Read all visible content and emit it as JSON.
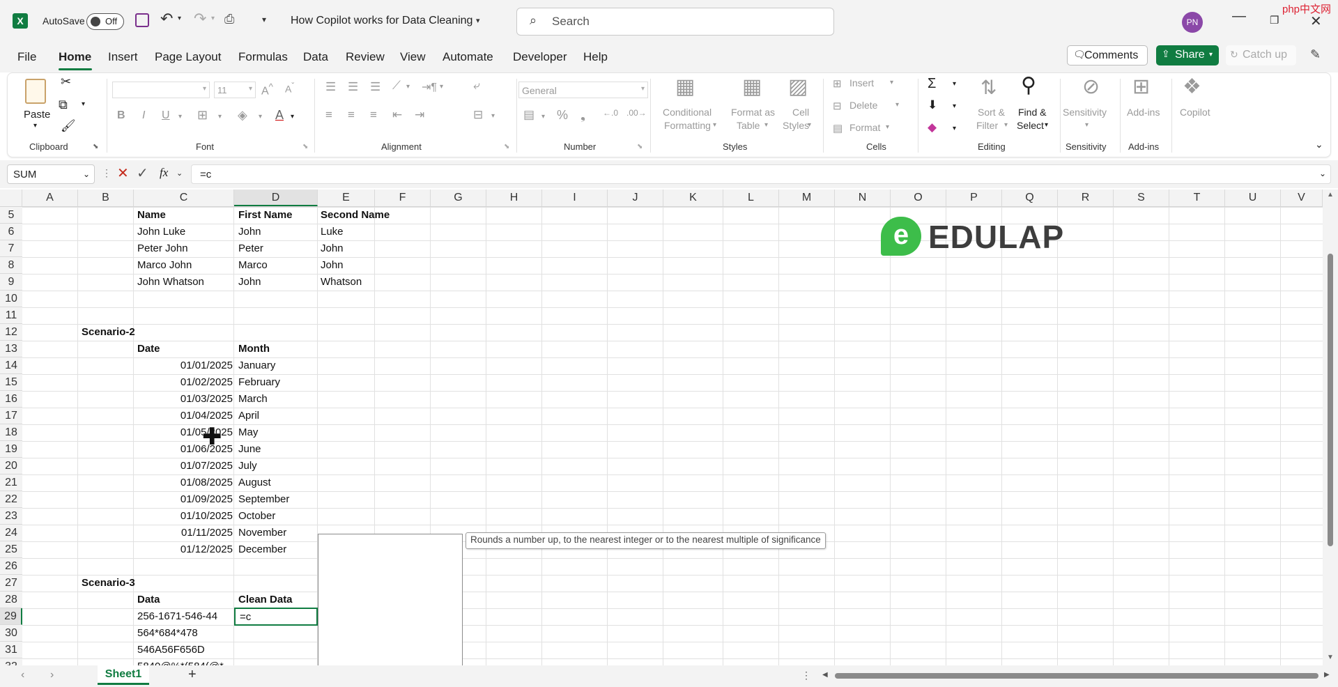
{
  "titlebar": {
    "autosave_label": "AutoSave",
    "autosave_state": "Off",
    "doc_title": "How Copilot works for Data Cleaning",
    "search_placeholder": "Search",
    "avatar_initials": "PN",
    "watermark": "php中文网"
  },
  "menu": {
    "tabs": [
      "File",
      "Home",
      "Insert",
      "Page Layout",
      "Formulas",
      "Data",
      "Review",
      "View",
      "Automate",
      "Developer",
      "Help"
    ],
    "comments": "Comments",
    "share": "Share",
    "catchup": "Catch up"
  },
  "ribbon": {
    "paste": "Paste",
    "font_size": "11",
    "number_format": "General",
    "cond_format": [
      "Conditional",
      "Formatting"
    ],
    "format_table": [
      "Format as",
      "Table"
    ],
    "cell_styles": [
      "Cell",
      "Styles"
    ],
    "cells": [
      "Insert",
      "Delete",
      "Format"
    ],
    "sort": [
      "Sort &",
      "Filter"
    ],
    "find": [
      "Find &",
      "Select"
    ],
    "sensitivity": "Sensitivity",
    "addins": "Add-ins",
    "copilot": "Copilot",
    "groups": [
      "Clipboard",
      "Font",
      "Alignment",
      "Number",
      "Styles",
      "Cells",
      "Editing",
      "Sensitivity",
      "Add-ins"
    ]
  },
  "formula_bar": {
    "name_box": "SUM",
    "fx": "fx",
    "formula": "=c"
  },
  "columns": [
    "A",
    "B",
    "C",
    "D",
    "E",
    "F",
    "G",
    "H",
    "I",
    "J",
    "K",
    "L",
    "M",
    "N",
    "O",
    "P",
    "Q",
    "R",
    "S",
    "T",
    "U",
    "V"
  ],
  "rows": [
    "5",
    "6",
    "7",
    "8",
    "9",
    "10",
    "11",
    "12",
    "13",
    "14",
    "15",
    "16",
    "17",
    "18",
    "19",
    "20",
    "21",
    "22",
    "23",
    "24",
    "25",
    "26",
    "27",
    "28",
    "29",
    "30",
    "31",
    "32"
  ],
  "cells": {
    "r5": [
      "Name",
      "First Name",
      "Second Name"
    ],
    "r6": [
      "John Luke",
      "John",
      "Luke"
    ],
    "r7": [
      "Peter John",
      "Peter",
      "John"
    ],
    "r8": [
      "Marco John",
      "Marco",
      "John"
    ],
    "r9": [
      "John Whatson",
      "John",
      "Whatson"
    ],
    "scenario2": "Scenario-2",
    "r13": [
      "Date",
      "Month"
    ],
    "dates": [
      "01/01/2025",
      "01/02/2025",
      "01/03/2025",
      "01/04/2025",
      "01/05/2025",
      "01/06/2025",
      "01/07/2025",
      "01/08/2025",
      "01/09/2025",
      "01/10/2025",
      "01/11/2025",
      "01/12/2025"
    ],
    "months": [
      "January",
      "February",
      "March",
      "April",
      "May",
      "June",
      "July",
      "August",
      "September",
      "October",
      "November",
      "December"
    ],
    "scenario3": "Scenario-3",
    "r28": [
      "Data",
      "Clean Data"
    ],
    "r29": [
      "256-1671-546-44",
      "=c"
    ],
    "r30": "564*684*478",
    "r31": "546A56F656D",
    "r32": "5840@%*(584(@*"
  },
  "tooltip": "Rounds a number up, to the nearest integer or to the nearest multiple of significance",
  "logo": {
    "text": "EDULAP",
    "colors": {
      "green": "#3dbd4a",
      "dark": "#3d3d3d"
    }
  },
  "sheet_tab": "Sheet1",
  "accent_color": "#107c41"
}
